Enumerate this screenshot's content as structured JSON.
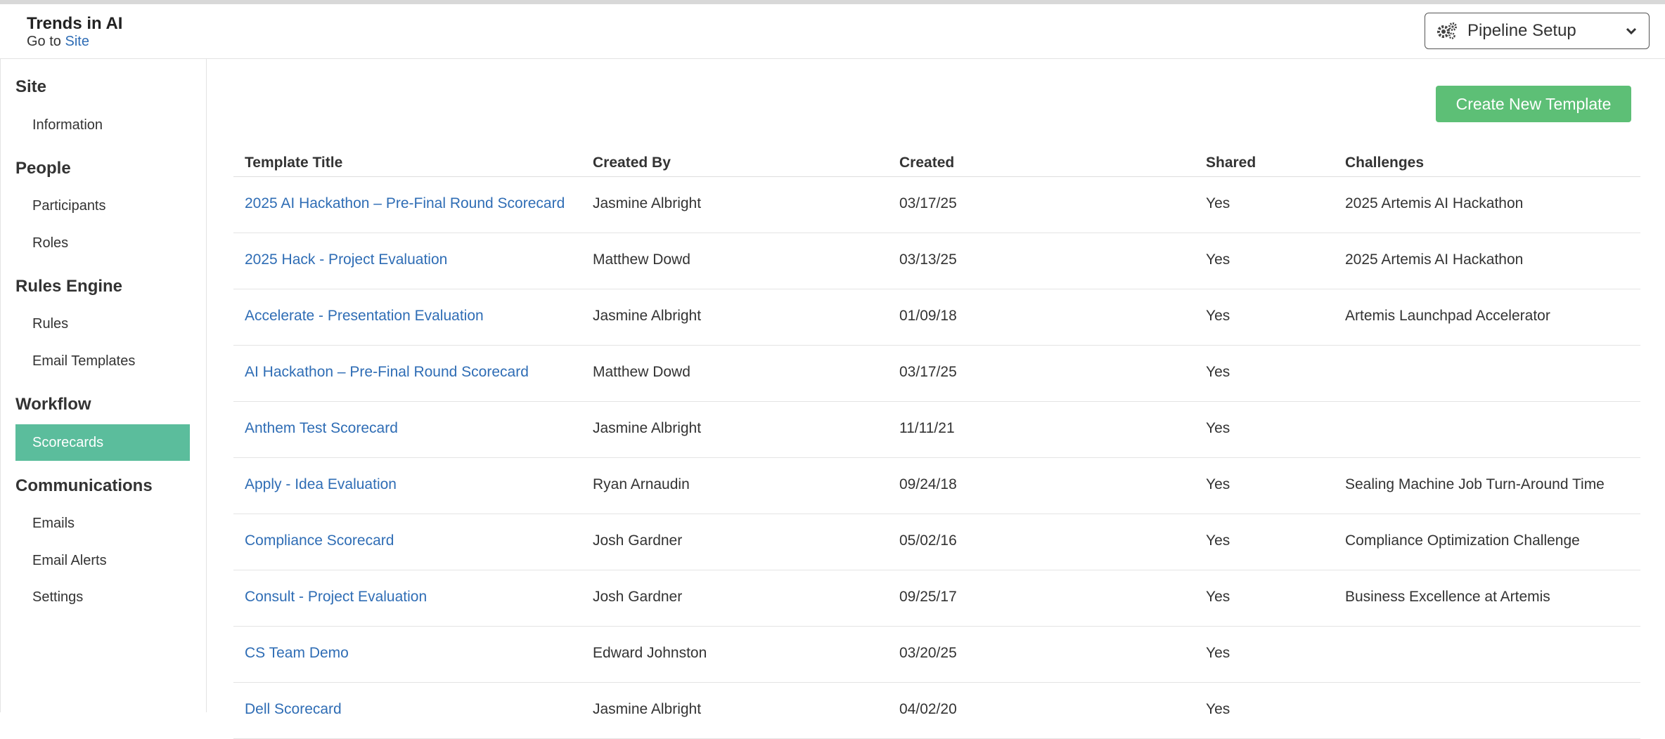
{
  "header": {
    "site_title": "Trends in AI",
    "goto_prefix": "Go to",
    "goto_link": "Site",
    "pipeline_label": "Pipeline Setup"
  },
  "sidebar": {
    "sections": [
      {
        "title": "Site",
        "items": [
          "Information"
        ]
      },
      {
        "title": "People",
        "items": [
          "Participants",
          "Roles"
        ]
      },
      {
        "title": "Rules Engine",
        "items": [
          "Rules",
          "Email Templates"
        ]
      },
      {
        "title": "Workflow",
        "items": [
          "Scorecards"
        ]
      },
      {
        "title": "Communications",
        "items": [
          "Emails",
          "Email Alerts",
          "Settings"
        ]
      }
    ],
    "active_item": "Scorecards"
  },
  "main": {
    "create_button": "Create New Template",
    "columns": [
      "Template Title",
      "Created By",
      "Created",
      "Shared",
      "Challenges"
    ],
    "rows": [
      {
        "title": "2025 AI Hackathon – Pre-Final Round Scorecard",
        "created_by": "Jasmine Albright",
        "created": "03/17/25",
        "shared": "Yes",
        "challenges": "2025 Artemis AI Hackathon"
      },
      {
        "title": "2025 Hack - Project Evaluation",
        "created_by": "Matthew Dowd",
        "created": "03/13/25",
        "shared": "Yes",
        "challenges": "2025 Artemis AI Hackathon"
      },
      {
        "title": "Accelerate - Presentation Evaluation",
        "created_by": "Jasmine Albright",
        "created": "01/09/18",
        "shared": "Yes",
        "challenges": "Artemis Launchpad Accelerator"
      },
      {
        "title": "AI Hackathon – Pre-Final Round Scorecard",
        "created_by": "Matthew Dowd",
        "created": "03/17/25",
        "shared": "Yes",
        "challenges": ""
      },
      {
        "title": "Anthem Test Scorecard",
        "created_by": "Jasmine Albright",
        "created": "11/11/21",
        "shared": "Yes",
        "challenges": ""
      },
      {
        "title": "Apply - Idea Evaluation",
        "created_by": "Ryan Arnaudin",
        "created": "09/24/18",
        "shared": "Yes",
        "challenges": "Sealing Machine Job Turn-Around Time"
      },
      {
        "title": "Compliance Scorecard",
        "created_by": "Josh Gardner",
        "created": "05/02/16",
        "shared": "Yes",
        "challenges": "Compliance Optimization Challenge"
      },
      {
        "title": "Consult - Project Evaluation",
        "created_by": "Josh Gardner",
        "created": "09/25/17",
        "shared": "Yes",
        "challenges": "Business Excellence at Artemis"
      },
      {
        "title": "CS Team Demo",
        "created_by": "Edward Johnston",
        "created": "03/20/25",
        "shared": "Yes",
        "challenges": ""
      },
      {
        "title": "Dell Scorecard",
        "created_by": "Jasmine Albright",
        "created": "04/02/20",
        "shared": "Yes",
        "challenges": ""
      }
    ]
  }
}
